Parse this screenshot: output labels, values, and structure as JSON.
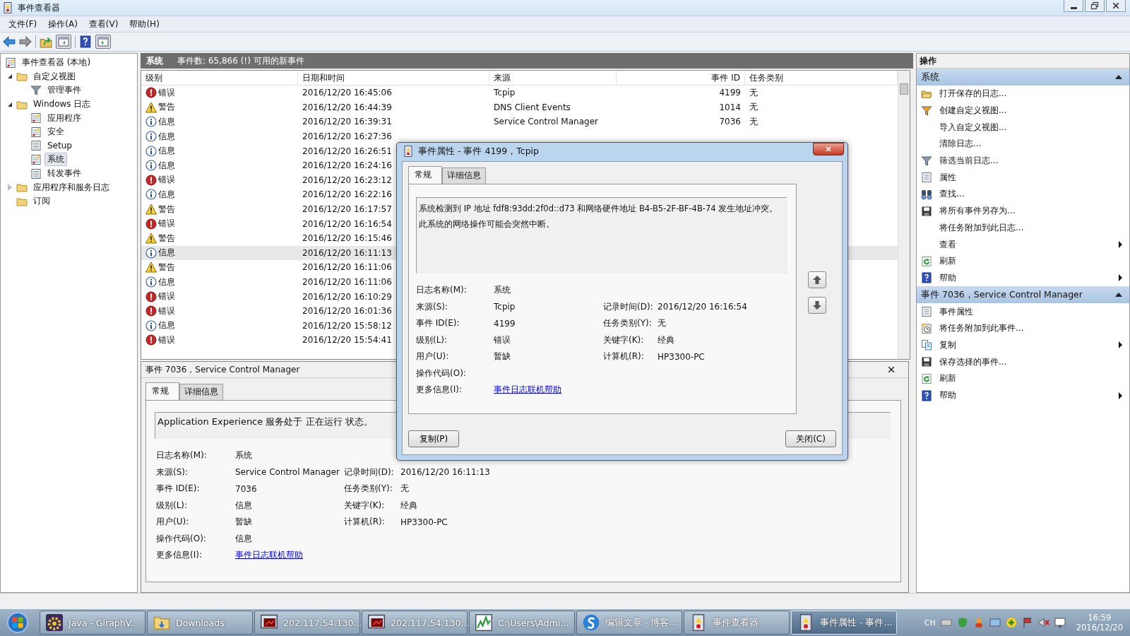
{
  "window": {
    "title": "事件查看器"
  },
  "menu": [
    "文件(F)",
    "操作(A)",
    "查看(V)",
    "帮助(H)"
  ],
  "tree": [
    {
      "label": "事件查看器 (本地)",
      "kind": "log",
      "selected": false,
      "children": [
        {
          "label": "自定义视图",
          "kind": "folder",
          "expanded": true,
          "selected": false,
          "children": [
            {
              "label": "管理事件",
              "kind": "filter",
              "selected": false
            }
          ]
        },
        {
          "label": "Windows 日志",
          "kind": "folder",
          "expanded": true,
          "selected": false,
          "children": [
            {
              "label": "应用程序",
              "kind": "log",
              "selected": false
            },
            {
              "label": "安全",
              "kind": "log",
              "selected": false
            },
            {
              "label": "Setup",
              "kind": "plainlog",
              "selected": false
            },
            {
              "label": "系统",
              "kind": "log",
              "selected": true
            },
            {
              "label": "转发事件",
              "kind": "plainlog",
              "selected": false
            }
          ]
        },
        {
          "label": "应用程序和服务日志",
          "kind": "folder",
          "expanded": false,
          "selected": false
        },
        {
          "label": "订阅",
          "kind": "folder",
          "selected": false
        }
      ]
    }
  ],
  "log_view": {
    "title": "系统",
    "summary": "事件数: 65,866 (!) 可用的新事件",
    "columns": [
      "级别",
      "日期和时间",
      "来源",
      "事件 ID",
      "任务类别"
    ],
    "rows": [
      {
        "kind": "error",
        "label": "错误",
        "date": "2016/12/20 16:45:06",
        "source": "Tcpip",
        "event_id": "4199",
        "category": "无",
        "selected": false
      },
      {
        "kind": "warning",
        "label": "警告",
        "date": "2016/12/20 16:44:39",
        "source": "DNS Client Events",
        "event_id": "1014",
        "category": "无",
        "selected": false
      },
      {
        "kind": "info",
        "label": "信息",
        "date": "2016/12/20 16:39:31",
        "source": "Service Control Manager",
        "event_id": "7036",
        "category": "无",
        "selected": false
      },
      {
        "kind": "info",
        "label": "信息",
        "date": "2016/12/20 16:27:36",
        "selected": false
      },
      {
        "kind": "info",
        "label": "信息",
        "date": "2016/12/20 16:26:51",
        "selected": false
      },
      {
        "kind": "info",
        "label": "信息",
        "date": "2016/12/20 16:24:16",
        "selected": false
      },
      {
        "kind": "error",
        "label": "错误",
        "date": "2016/12/20 16:23:12",
        "selected": false
      },
      {
        "kind": "info",
        "label": "信息",
        "date": "2016/12/20 16:22:16",
        "selected": false
      },
      {
        "kind": "warning",
        "label": "警告",
        "date": "2016/12/20 16:17:57",
        "selected": false
      },
      {
        "kind": "error",
        "label": "错误",
        "date": "2016/12/20 16:16:54",
        "selected": false
      },
      {
        "kind": "warning",
        "label": "警告",
        "date": "2016/12/20 16:15:46",
        "selected": false
      },
      {
        "kind": "info",
        "label": "信息",
        "date": "2016/12/20 16:11:13",
        "selected": true
      },
      {
        "kind": "warning",
        "label": "警告",
        "date": "2016/12/20 16:11:06",
        "selected": false
      },
      {
        "kind": "info",
        "label": "信息",
        "date": "2016/12/20 16:11:06",
        "selected": false
      },
      {
        "kind": "error",
        "label": "错误",
        "date": "2016/12/20 16:10:29",
        "selected": false
      },
      {
        "kind": "error",
        "label": "错误",
        "date": "2016/12/20 16:01:36",
        "selected": false
      },
      {
        "kind": "info",
        "label": "信息",
        "date": "2016/12/20 15:58:12",
        "selected": false
      },
      {
        "kind": "error",
        "label": "错误",
        "date": "2016/12/20 15:54:41",
        "selected": false
      }
    ]
  },
  "detail_panel": {
    "title": "事件 7036，Service Control Manager",
    "tabs": [
      {
        "label": "常规",
        "selected": true
      },
      {
        "label": "详细信息",
        "selected": false
      }
    ],
    "description": [
      "Application Experience 服务处于 正在运行 状态。"
    ],
    "fields": [
      {
        "left": {
          "label": "日志名称(M):",
          "value": "系统",
          "kind": "text"
        }
      },
      {
        "left": {
          "label": "来源(S):",
          "value": "Service Control Manager",
          "kind": "text"
        },
        "right": {
          "label": "记录时间(D):",
          "value": "2016/12/20 16:11:13"
        }
      },
      {
        "left": {
          "label": "事件 ID(E):",
          "value": "7036",
          "kind": "text"
        },
        "right": {
          "label": "任务类别(Y):",
          "value": "无"
        }
      },
      {
        "left": {
          "label": "级别(L):",
          "value": "信息",
          "kind": "text"
        },
        "right": {
          "label": "关键字(K):",
          "value": "经典"
        }
      },
      {
        "left": {
          "label": "用户(U):",
          "value": "暂缺",
          "kind": "text"
        },
        "right": {
          "label": "计算机(R):",
          "value": "HP3300-PC"
        }
      },
      {
        "left": {
          "label": "操作代码(O):",
          "value": "信息",
          "kind": "text"
        }
      },
      {
        "left": {
          "label": "更多信息(I):",
          "value": "事件日志联机帮助",
          "kind": "link"
        }
      }
    ]
  },
  "dialog": {
    "title": "事件属性 - 事件 4199，Tcpip",
    "tabs": [
      {
        "label": "常规",
        "selected": true
      },
      {
        "label": "详细信息",
        "selected": false
      }
    ],
    "description": [
      "系统检测到 IP 地址 fdf8:93dd:2f0d::d73 和网络硬件地址 B4-B5-2F-BF-4B-74 发生地址冲突。",
      "此系统的网络操作可能会突然中断。"
    ],
    "fields": [
      {
        "left": {
          "label": "日志名称(M):",
          "value": "系统",
          "kind": "text"
        }
      },
      {
        "left": {
          "label": "来源(S):",
          "value": "Tcpip",
          "kind": "text"
        },
        "right": {
          "label": "记录时间(D):",
          "value": "2016/12/20 16:16:54"
        }
      },
      {
        "left": {
          "label": "事件 ID(E):",
          "value": "4199",
          "kind": "text"
        },
        "right": {
          "label": "任务类别(Y):",
          "value": "无"
        }
      },
      {
        "left": {
          "label": "级别(L):",
          "value": "错误",
          "kind": "text"
        },
        "right": {
          "label": "关键字(K):",
          "value": "经典"
        }
      },
      {
        "left": {
          "label": "用户(U):",
          "value": "暂缺",
          "kind": "text"
        },
        "right": {
          "label": "计算机(R):",
          "value": "HP3300-PC"
        }
      },
      {
        "left": {
          "label": "操作代码(O):"
        }
      },
      {
        "left": {
          "label": "更多信息(I):",
          "value": "事件日志联机帮助",
          "kind": "link"
        }
      }
    ],
    "buttons": [
      "复制(P)",
      "关闭(C)"
    ]
  },
  "actions": {
    "title": "操作",
    "sections": [
      {
        "title": "系统",
        "expanded": true,
        "items": [
          {
            "label": "打开保存的日志...",
            "kind": "open",
            "submenu": false
          },
          {
            "label": "创建自定义视图...",
            "kind": "filtercolor",
            "submenu": false
          },
          {
            "label": "导入自定义视图...",
            "kind": "plain",
            "submenu": false
          },
          {
            "label": "清除日志...",
            "kind": "plain",
            "submenu": false
          },
          {
            "label": "筛选当前日志...",
            "kind": "filter",
            "submenu": false
          },
          {
            "label": "属性",
            "kind": "props",
            "submenu": false
          },
          {
            "label": "查找...",
            "kind": "find",
            "submenu": false
          },
          {
            "label": "将所有事件另存为...",
            "kind": "save",
            "submenu": false
          },
          {
            "label": "将任务附加到此日志...",
            "kind": "plain",
            "submenu": false
          },
          {
            "label": "查看",
            "kind": "plain",
            "submenu": true
          },
          {
            "label": "刷新",
            "kind": "refresh",
            "submenu": false
          },
          {
            "label": "帮助",
            "kind": "help",
            "submenu": true
          }
        ]
      },
      {
        "title": "事件 7036，Service Control Manager",
        "expanded": true,
        "items": [
          {
            "label": "事件属性",
            "kind": "props",
            "submenu": false
          },
          {
            "label": "将任务附加到此事件...",
            "kind": "clock",
            "submenu": false
          },
          {
            "label": "复制",
            "kind": "copy",
            "submenu": true
          },
          {
            "label": "保存选择的事件...",
            "kind": "save",
            "submenu": false
          },
          {
            "label": "刷新",
            "kind": "refresh",
            "submenu": false
          },
          {
            "label": "帮助",
            "kind": "help",
            "submenu": true
          }
        ]
      }
    ]
  },
  "taskbar": {
    "items": [
      {
        "label": "Java - GiraphV...",
        "kind": "java",
        "selected": false
      },
      {
        "label": "Downloads",
        "kind": "tfolder",
        "selected": false
      },
      {
        "label": "202.117.54.130...",
        "kind": "remote",
        "selected": false
      },
      {
        "label": "202.117.54.130...",
        "kind": "remote",
        "selected": false
      },
      {
        "label": "C:\\Users\\Admi...",
        "kind": "chart",
        "selected": false
      },
      {
        "label": "编辑文章 - 博客...",
        "kind": "browser",
        "selected": false
      },
      {
        "label": "事件查看器",
        "kind": "evlog",
        "selected": false
      },
      {
        "label": "事件属性 - 事件...",
        "kind": "evlog",
        "selected": true
      }
    ],
    "language": "CH",
    "time": "16:59",
    "date": "2016/12/20"
  }
}
